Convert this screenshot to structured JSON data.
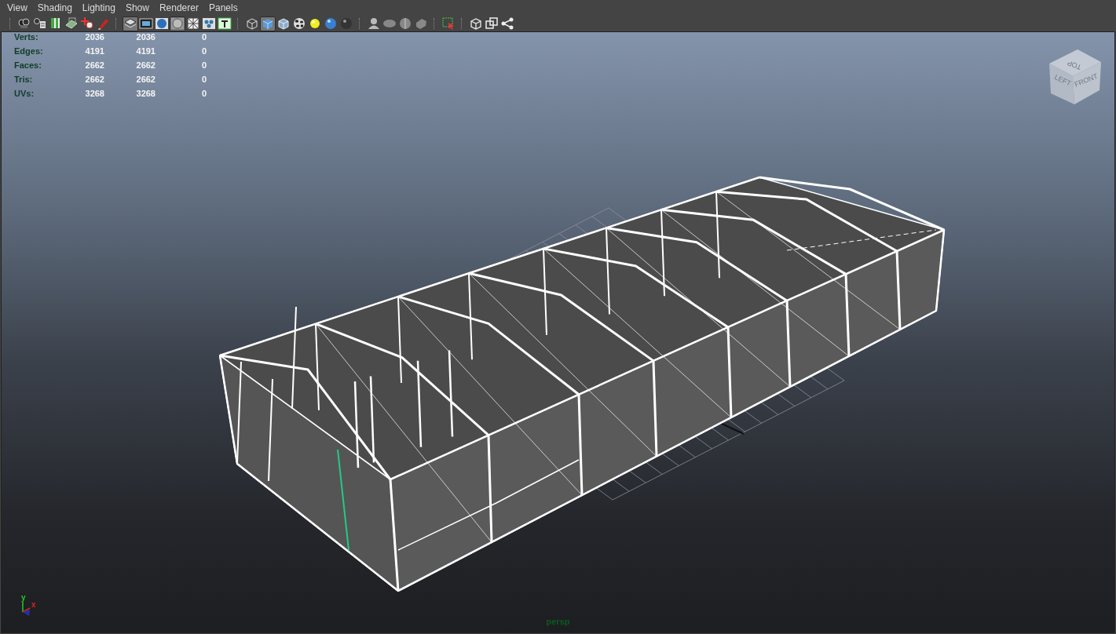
{
  "menu": [
    {
      "label": "View"
    },
    {
      "label": "Shading"
    },
    {
      "label": "Lighting"
    },
    {
      "label": "Show"
    },
    {
      "label": "Renderer"
    },
    {
      "label": "Panels"
    }
  ],
  "toolbar": [
    {
      "buttons": [
        {
          "pressed": false
        },
        {
          "pressed": false
        },
        {
          "pressed": false
        },
        {
          "pressed": false
        },
        {
          "pressed": false
        },
        {
          "pressed": false
        }
      ]
    },
    {
      "buttons": [
        {
          "pressed": true
        },
        {
          "pressed": false
        },
        {
          "pressed": false
        },
        {
          "pressed": true
        },
        {
          "pressed": false
        },
        {
          "pressed": false
        },
        {
          "pressed": false
        }
      ]
    },
    {
      "buttons": [
        {
          "pressed": false
        },
        {
          "pressed": true
        },
        {
          "pressed": false
        },
        {
          "pressed": false
        },
        {
          "pressed": false
        },
        {
          "pressed": false
        },
        {
          "pressed": false
        }
      ]
    },
    {
      "buttons": [
        {
          "pressed": false
        },
        {
          "pressed": false
        },
        {
          "pressed": false
        },
        {
          "pressed": false
        }
      ]
    },
    {
      "buttons": [
        {
          "pressed": false
        }
      ]
    },
    {
      "buttons": [
        {
          "pressed": false
        },
        {
          "pressed": false
        },
        {
          "pressed": false
        }
      ]
    }
  ],
  "stats": [
    {
      "label": "Verts:",
      "values": [
        "2036",
        "2036",
        "0"
      ]
    },
    {
      "label": "Edges:",
      "values": [
        "4191",
        "4191",
        "0"
      ]
    },
    {
      "label": "Faces:",
      "values": [
        "2662",
        "2662",
        "0"
      ]
    },
    {
      "label": "Tris:",
      "values": [
        "2662",
        "2662",
        "0"
      ]
    },
    {
      "label": "UVs:",
      "values": [
        "3268",
        "3268",
        "0"
      ]
    }
  ],
  "view_cube": {
    "faces": [
      "TOP",
      "LEFT",
      "FRONT"
    ]
  },
  "axis": {
    "labels": [
      "y",
      "x"
    ]
  },
  "camera": "persp"
}
